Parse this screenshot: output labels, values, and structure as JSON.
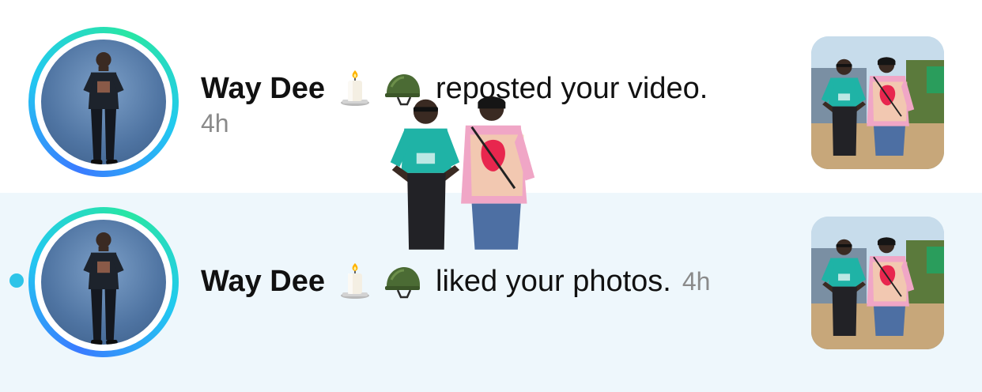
{
  "notifications": [
    {
      "username": "Way Dee",
      "action": "reposted your video.",
      "time": "4h",
      "unread": false
    },
    {
      "username": "Way Dee",
      "action": "liked your photos.",
      "time": "4h",
      "unread": true
    }
  ],
  "icons": [
    "candle-icon",
    "military-helmet-icon"
  ],
  "colors": {
    "row_highlight": "#eef7fc",
    "unread_dot": "#2ec4e8",
    "ring_blue": "#3a7bff",
    "ring_green": "#29e6a3",
    "shirt_teal": "#1fb3a6",
    "sweater_pink": "#f0a6c6"
  }
}
